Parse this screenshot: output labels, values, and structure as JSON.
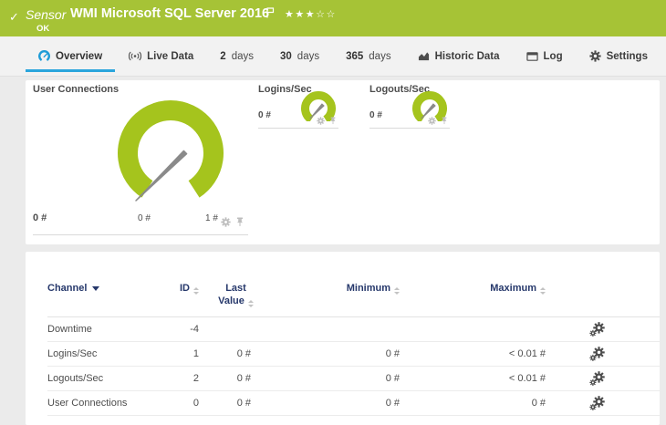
{
  "header": {
    "check_icon": "✓",
    "type_label": "Sensor",
    "title": "WMI Microsoft SQL Server 2016",
    "status": "OK",
    "stars_filled": "★★★",
    "stars_empty": "☆☆"
  },
  "tabs": [
    {
      "label": "Overview",
      "icon": "gauge-icon",
      "active": true
    },
    {
      "label": "Live Data",
      "icon": "live-data-icon"
    },
    {
      "num": "2",
      "label": "days"
    },
    {
      "num": "30",
      "label": "days"
    },
    {
      "num": "365",
      "label": "days"
    },
    {
      "label": "Historic Data",
      "icon": "area-chart-icon"
    },
    {
      "label": "Log",
      "icon": "log-icon"
    },
    {
      "label": "Settings",
      "icon": "gear-icon"
    }
  ],
  "gauges": {
    "primary": {
      "title": "User Connections",
      "value": "0 #",
      "scale_min": "0 #",
      "scale_max": "1 #"
    },
    "logins": {
      "title": "Logins/Sec",
      "value": "0 #"
    },
    "logouts": {
      "title": "Logouts/Sec",
      "value": "0 #"
    }
  },
  "table": {
    "col_channel": "Channel",
    "col_id": "ID",
    "col_last_1": "Last",
    "col_last_2": "Value",
    "col_min": "Minimum",
    "col_max": "Maximum",
    "rows": [
      {
        "channel": "Downtime",
        "id": "-4",
        "last": "",
        "min": "",
        "max": ""
      },
      {
        "channel": "Logins/Sec",
        "id": "1",
        "last": "0 #",
        "min": "0 #",
        "max": "< 0.01 #"
      },
      {
        "channel": "Logouts/Sec",
        "id": "2",
        "last": "0 #",
        "min": "0 #",
        "max": "< 0.01 #"
      },
      {
        "channel": "User Connections",
        "id": "0",
        "last": "0 #",
        "min": "0 #",
        "max": "0 #"
      }
    ]
  },
  "colors": {
    "status_ok_green": "#a6c336",
    "gauge_green": "#a5c41d",
    "active_tab_blue": "#2aa5dc",
    "table_header_navy": "#26386b"
  }
}
